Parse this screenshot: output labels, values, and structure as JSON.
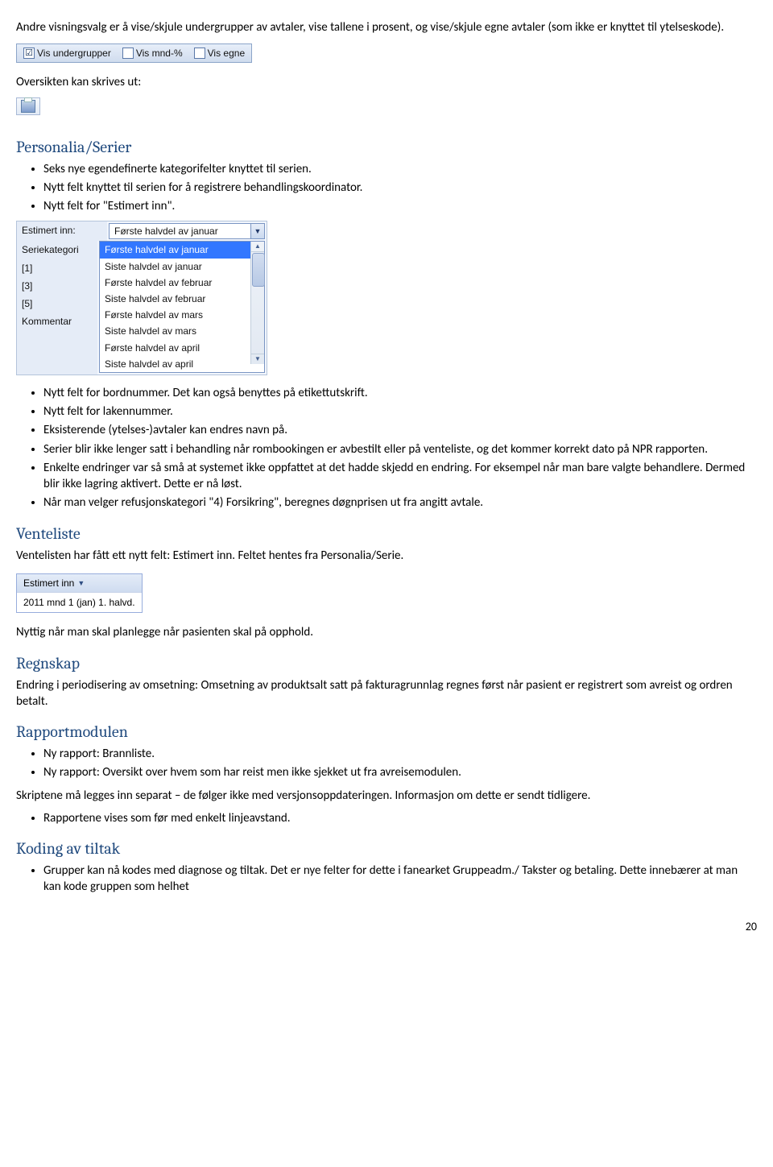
{
  "intro": "Andre visningsvalg er å vise/skjule undergrupper av avtaler, vise tallene i prosent, og vise/skjule egne avtaler (som ikke er knyttet til ytelseskode).",
  "checks": {
    "c1_checked": "☑",
    "c1": "Vis undergrupper",
    "c2": "Vis mnd-%",
    "c3": "Vis egne"
  },
  "overs_1": "Oversikten kan skrives ut:",
  "sec_personalia": "Personalia/Serier",
  "bul_personalia": [
    "Seks nye egendefinerte kategorifelter knyttet til serien.",
    "Nytt felt knyttet til serien for å registrere behandlingskoordinator.",
    "Nytt felt for \"Estimert inn\"."
  ],
  "dd": {
    "field_label": "Estimert inn:",
    "current": "Første halvdel av januar",
    "options": [
      "Første halvdel av januar",
      "Siste halvdel av januar",
      "Første halvdel av februar",
      "Siste halvdel av februar",
      "Første halvdel av mars",
      "Siste halvdel av mars",
      "Første halvdel av april",
      "Siste halvdel av april"
    ],
    "side_rows": [
      "Seriekategori",
      "[1]",
      "[3]",
      "[5]",
      "Kommentar"
    ]
  },
  "bul_personalia2": [
    "Nytt felt for bordnummer. Det kan også benyttes på etikettutskrift.",
    "Nytt felt for lakennummer.",
    "Eksisterende (ytelses-)avtaler kan endres navn på.",
    "Serier blir ikke lenger satt i behandling når rombookingen er avbestilt eller på venteliste, og det kommer korrekt dato på NPR rapporten.",
    "Enkelte endringer var så små at systemet ikke oppfattet at det hadde skjedd en endring. For eksempel når man bare valgte behandlere. Dermed blir ikke lagring aktivert. Dette er nå løst.",
    "Når man velger refusjonskategori \"4) Forsikring\", beregnes døgnprisen ut fra angitt avtale."
  ],
  "sec_venteliste": "Venteliste",
  "vent_p1": "Ventelisten har fått ett nytt felt: Estimert inn. Feltet hentes fra Personalia/Serie.",
  "vent_box_header": "Estimert inn",
  "vent_box_value": "2011 mnd 1 (jan) 1. halvd.",
  "vent_p2": "Nyttig når man skal planlegge når pasienten skal på opphold.",
  "sec_regnskap": "Regnskap",
  "regnskap_p": "Endring i periodisering av omsetning: Omsetning av produktsalt satt på fakturagrunnlag regnes først når pasient er registrert som avreist og ordren betalt.",
  "sec_rapport": "Rapportmodulen",
  "bul_rapport1": [
    "Ny rapport: Brannliste.",
    "Ny rapport: Oversikt over hvem som har reist men ikke sjekket ut fra avreisemodulen."
  ],
  "rapport_p": "Skriptene må legges inn separat – de følger ikke med versjonsoppdateringen. Informasjon om dette er sendt tidligere.",
  "bul_rapport2": [
    "Rapportene vises som før med enkelt linjeavstand."
  ],
  "sec_koding": "Koding av tiltak",
  "bul_koding": [
    "Grupper kan nå kodes med diagnose og tiltak. Det er nye felter for dette i fanearket Gruppeadm./ Takster og betaling. Dette innebærer at man kan kode gruppen som helhet"
  ],
  "page": "20"
}
